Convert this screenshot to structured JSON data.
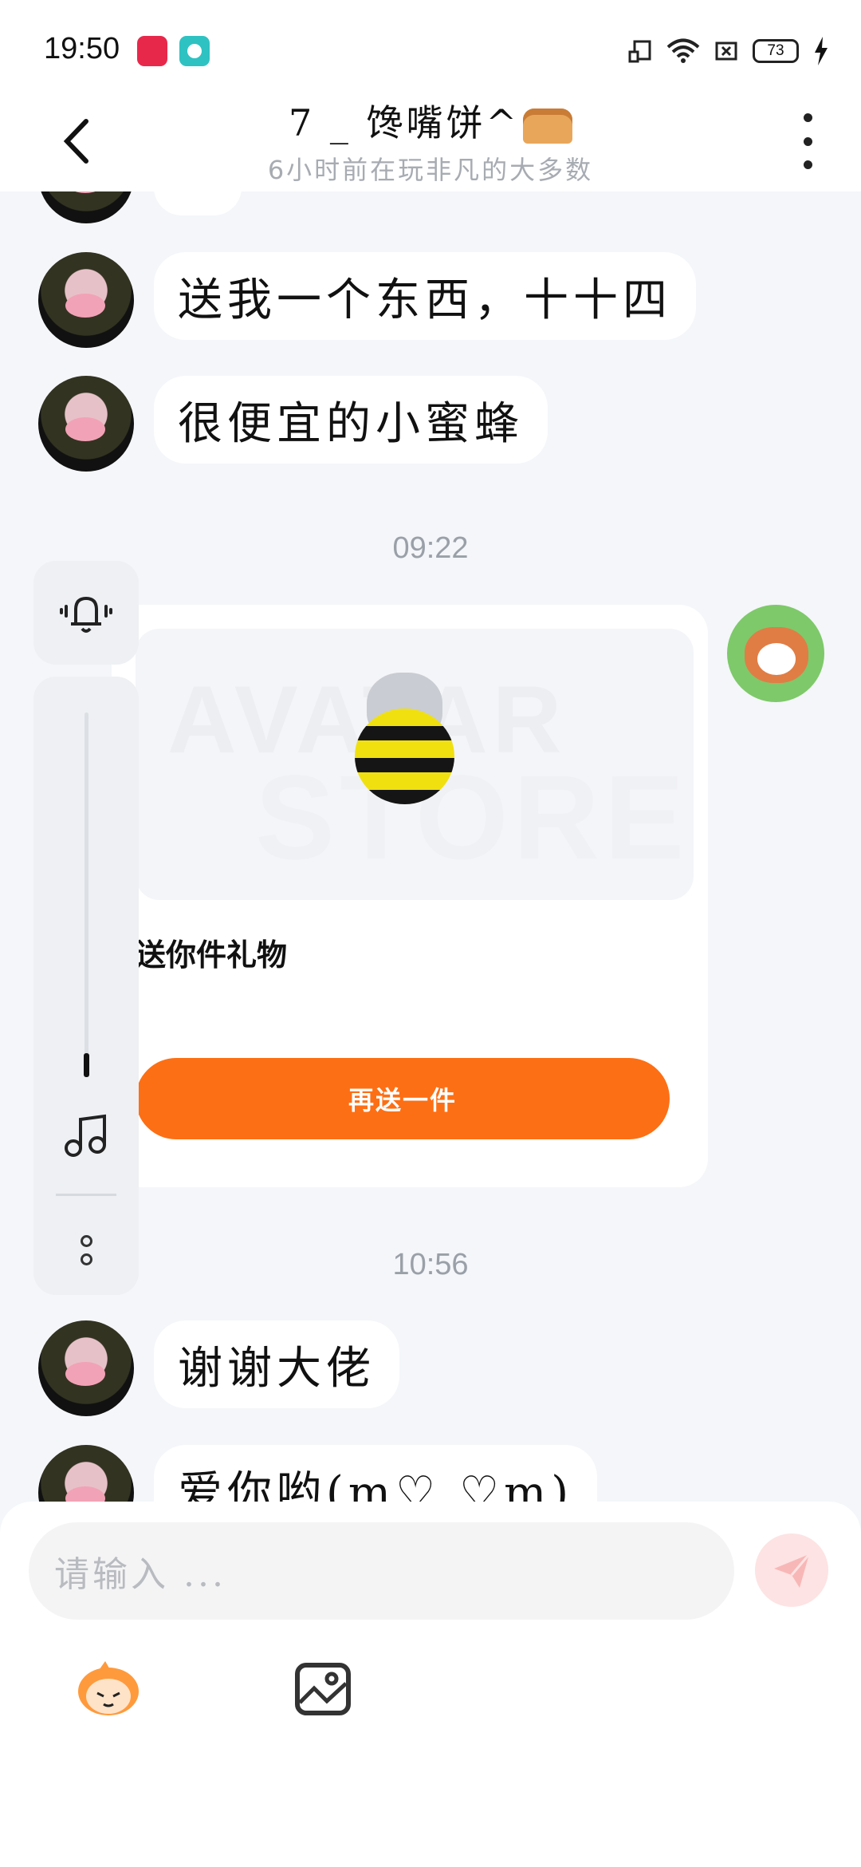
{
  "status_bar": {
    "time": "19:50",
    "battery": "73",
    "icons": [
      "cast-icon",
      "wifi-icon",
      "close-box-icon",
      "battery-icon",
      "charging-icon"
    ]
  },
  "header": {
    "title": "7 _ 馋嘴饼^",
    "subtitle": "6小时前在玩非凡的大多数"
  },
  "messages": [
    {
      "side": "left",
      "text": "送我一个东西，十十四"
    },
    {
      "side": "left",
      "text": "很便宜的小蜜蜂"
    },
    {
      "type": "timestamp",
      "text": "09:22"
    },
    {
      "side": "right",
      "type": "gift",
      "image_watermark": [
        "AVATAR",
        "STORE"
      ],
      "text": "送你件礼物",
      "button": "再送一件"
    },
    {
      "type": "timestamp",
      "text": "10:56"
    },
    {
      "side": "left",
      "text": "谢谢大佬"
    },
    {
      "side": "left",
      "text": "爱你哟(ɱ♡ ♡ɱ)"
    }
  ],
  "composer": {
    "placeholder": "请输入 ...",
    "accent": "#fd6f14"
  }
}
